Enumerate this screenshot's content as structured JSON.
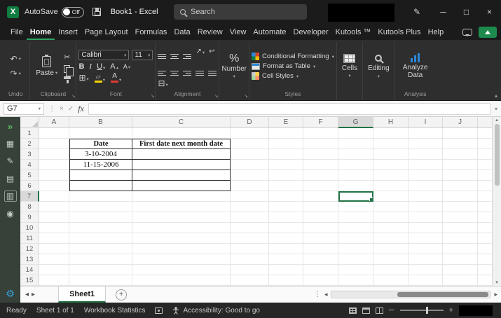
{
  "title_bar": {
    "autosave_label": "AutoSave",
    "autosave_state": "Off",
    "document_title": "Book1 - Excel",
    "search_placeholder": "Search"
  },
  "menu_bar": {
    "tabs": [
      "File",
      "Home",
      "Insert",
      "Page Layout",
      "Formulas",
      "Data",
      "Review",
      "View",
      "Automate",
      "Developer",
      "Kutools ™",
      "Kutools Plus",
      "Help"
    ],
    "active_tab": "Home"
  },
  "ribbon": {
    "undo_group_label": "Undo",
    "clipboard_group_label": "Clipboard",
    "paste_label": "Paste",
    "font_group_label": "Font",
    "font_name": "Calibri",
    "font_size": "11",
    "bold": "B",
    "italic": "I",
    "underline": "U",
    "grow_font": "A",
    "shrink_font": "A",
    "font_color_letter": "A",
    "alignment_group_label": "Alignment",
    "number_label": "Number",
    "conditional_formatting": "Conditional Formatting",
    "format_as_table": "Format as Table",
    "cell_styles": "Cell Styles",
    "styles_group_label": "Styles",
    "cells_label": "Cells",
    "editing_label": "Editing",
    "analyze_data_label": "Analyze Data",
    "analysis_group_label": "Analysis"
  },
  "formula_bar": {
    "name_box": "G7",
    "fx_label": "fx",
    "formula_value": ""
  },
  "grid": {
    "columns": [
      "A",
      "B",
      "C",
      "D",
      "E",
      "F",
      "G",
      "H",
      "I",
      "J"
    ],
    "row_count": 15,
    "selected_cell": "G7",
    "cells": [
      {
        "ref": "B2",
        "text": "Date",
        "bold": true
      },
      {
        "ref": "C2",
        "text": "First date next month date",
        "bold": true
      },
      {
        "ref": "B3",
        "text": "3-10-2004",
        "bold": false
      },
      {
        "ref": "B4",
        "text": "11-15-2006",
        "bold": false
      }
    ],
    "table_range": {
      "cols": [
        "B",
        "C"
      ],
      "row_start": 2,
      "row_end": 6
    }
  },
  "sheet_tabs": {
    "active_tab": "Sheet1",
    "add_label": "+"
  },
  "status_bar": {
    "mode": "Ready",
    "sheet_count": "Sheet 1 of 1",
    "workbook_statistics": "Workbook Statistics",
    "accessibility": "Accessibility: Good to go"
  },
  "icons": {
    "app_letter": "X",
    "dropdown": "▾",
    "undo": "↶",
    "redo": "↷",
    "cut": "✂",
    "borders": "⊞",
    "merge": "⊟",
    "fill_shape": "▱",
    "wrap": "↩",
    "orientation": "↗",
    "percent": "%",
    "minimize": "─",
    "maximize": "□",
    "close": "×",
    "pencil": "✎",
    "dots_vertical": "⋮",
    "cancel": "×",
    "enter": "✓",
    "expand_pane": "»",
    "sidebar_1": "▦",
    "sidebar_2": "✎",
    "sidebar_3": "▤",
    "sidebar_4": "▥",
    "sidebar_5": "◉",
    "gear": "⚙",
    "scroll_up": "▴",
    "scroll_down": "▾",
    "tab_prev": "◂",
    "tab_next": "▸",
    "collapse_ribbon": "▴",
    "launcher": "↘"
  },
  "colors": {
    "excel_green": "#107C41",
    "selection_green": "#217346",
    "active_tab_underline": "#2EA263"
  }
}
